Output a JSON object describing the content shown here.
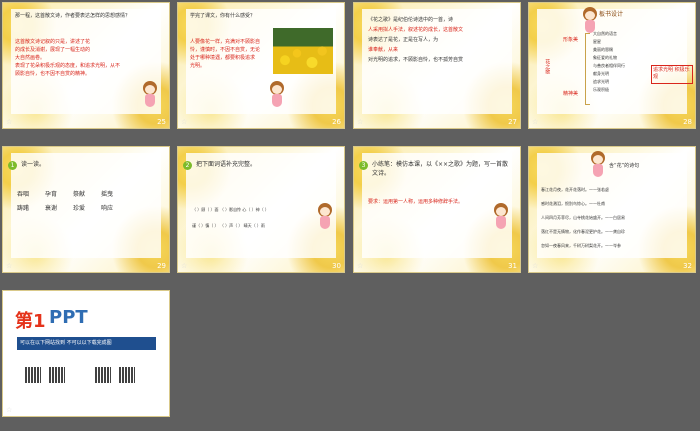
{
  "slides": [
    {
      "num": "25",
      "lines": [
        "那一程，这首散文诗，作者要表达怎样的思想感情？",
        "这首散文诗记叙的只是，讲述了花",
        "的成长及消谢，展现了一幅生动的",
        "大自然画卷。",
        "表现了花朵积极乐观的态度，和追求光明，从不",
        "顾影自怜，也不因不自赏的精神。"
      ]
    },
    {
      "num": "26",
      "lines": [
        "学完了课文，你有什么感受？",
        "人要像花一样，充满对不顾影自",
        "怜，谨慎时，不因不自赏，无论",
        "处于哪种境遇，都要积极追求",
        "光明。"
      ]
    },
    {
      "num": "27",
      "lines": [
        "《花之歌》是纪伯伦诗选中的一首，诗",
        "人采用拟人手法，叙述花的成长，这首散文",
        "诗表达了是花，正是在写人，为",
        "谁奉献，从来",
        "对光明的追求，不顾影自怜，也不孤芳自赏"
      ]
    },
    {
      "num": "28",
      "title": "板书设计",
      "left": "花之歌",
      "mid1": "形象美",
      "mid2": "精神美",
      "items": [
        "大自然的语言",
        "星星",
        "美丽的恩赐",
        "象征爱的礼物",
        "与善良者相伴同行",
        "献身光明",
        "追求光明",
        "乐观积极"
      ],
      "right": "追求光明 积极乐观"
    },
    {
      "num": "29",
      "badge": "1",
      "title": "读一读。",
      "words": [
        "吞咽",
        "孕育",
        "祭献",
        "摇曳",
        "踌躇",
        "衰谢",
        "珍爱",
        "响应"
      ]
    },
    {
      "num": "30",
      "badge": "2",
      "title": "把下面词语补充完整。",
      "rows": [
        "（ ）顾（ ）面  （ ）影自怜  心（ ）神（ ）",
        "谨（ ）慎（ ）  （ ）声（ ）  晴天（ ）雨"
      ]
    },
    {
      "num": "31",
      "badge": "3",
      "title": "小练笔：模仿本课，以《××之歌》为题，写一首散文诗。",
      "req": "要求：运用第一人称，运用多种修辞手法。"
    },
    {
      "num": "32",
      "title": "含“花”的诗句",
      "lines": [
        "春江花月夜，花开花落时。——张若虚",
        "感时花溅泪，恨别鸟惊心。——杜甫",
        "人间四月芳菲尽，山寺桃花始盛开。——白居易",
        "落红不是无情物，化作春泥更护花。——龚自珍",
        "忽如一夜春风来，千树万树梨花开。——岑参"
      ]
    },
    {
      "num": "33",
      "logo_a": "第1",
      "logo_b": "PPT",
      "bar": "可以在以下网站找到  不可以以下载完成图"
    }
  ],
  "colors": {
    "accent": "#d9261c",
    "badge": "#7dbb2a",
    "bg": "#5f5f5f"
  }
}
